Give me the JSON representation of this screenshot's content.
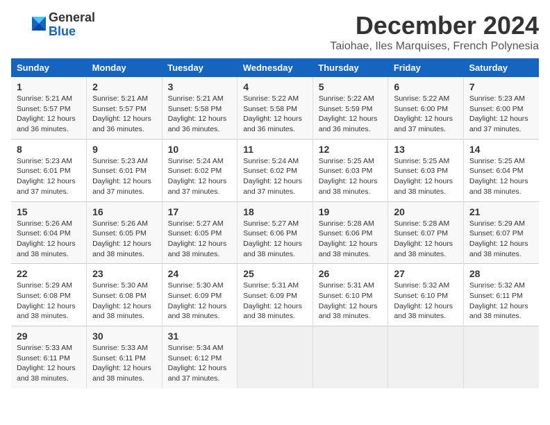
{
  "header": {
    "logo_general": "General",
    "logo_blue": "Blue",
    "month": "December 2024",
    "location": "Taiohae, Iles Marquises, French Polynesia"
  },
  "days_of_week": [
    "Sunday",
    "Monday",
    "Tuesday",
    "Wednesday",
    "Thursday",
    "Friday",
    "Saturday"
  ],
  "weeks": [
    [
      {
        "day": "1",
        "info": "Sunrise: 5:21 AM\nSunset: 5:57 PM\nDaylight: 12 hours\nand 36 minutes."
      },
      {
        "day": "2",
        "info": "Sunrise: 5:21 AM\nSunset: 5:57 PM\nDaylight: 12 hours\nand 36 minutes."
      },
      {
        "day": "3",
        "info": "Sunrise: 5:21 AM\nSunset: 5:58 PM\nDaylight: 12 hours\nand 36 minutes."
      },
      {
        "day": "4",
        "info": "Sunrise: 5:22 AM\nSunset: 5:58 PM\nDaylight: 12 hours\nand 36 minutes."
      },
      {
        "day": "5",
        "info": "Sunrise: 5:22 AM\nSunset: 5:59 PM\nDaylight: 12 hours\nand 36 minutes."
      },
      {
        "day": "6",
        "info": "Sunrise: 5:22 AM\nSunset: 6:00 PM\nDaylight: 12 hours\nand 37 minutes."
      },
      {
        "day": "7",
        "info": "Sunrise: 5:23 AM\nSunset: 6:00 PM\nDaylight: 12 hours\nand 37 minutes."
      }
    ],
    [
      {
        "day": "8",
        "info": "Sunrise: 5:23 AM\nSunset: 6:01 PM\nDaylight: 12 hours\nand 37 minutes."
      },
      {
        "day": "9",
        "info": "Sunrise: 5:23 AM\nSunset: 6:01 PM\nDaylight: 12 hours\nand 37 minutes."
      },
      {
        "day": "10",
        "info": "Sunrise: 5:24 AM\nSunset: 6:02 PM\nDaylight: 12 hours\nand 37 minutes."
      },
      {
        "day": "11",
        "info": "Sunrise: 5:24 AM\nSunset: 6:02 PM\nDaylight: 12 hours\nand 37 minutes."
      },
      {
        "day": "12",
        "info": "Sunrise: 5:25 AM\nSunset: 6:03 PM\nDaylight: 12 hours\nand 38 minutes."
      },
      {
        "day": "13",
        "info": "Sunrise: 5:25 AM\nSunset: 6:03 PM\nDaylight: 12 hours\nand 38 minutes."
      },
      {
        "day": "14",
        "info": "Sunrise: 5:25 AM\nSunset: 6:04 PM\nDaylight: 12 hours\nand 38 minutes."
      }
    ],
    [
      {
        "day": "15",
        "info": "Sunrise: 5:26 AM\nSunset: 6:04 PM\nDaylight: 12 hours\nand 38 minutes."
      },
      {
        "day": "16",
        "info": "Sunrise: 5:26 AM\nSunset: 6:05 PM\nDaylight: 12 hours\nand 38 minutes."
      },
      {
        "day": "17",
        "info": "Sunrise: 5:27 AM\nSunset: 6:05 PM\nDaylight: 12 hours\nand 38 minutes."
      },
      {
        "day": "18",
        "info": "Sunrise: 5:27 AM\nSunset: 6:06 PM\nDaylight: 12 hours\nand 38 minutes."
      },
      {
        "day": "19",
        "info": "Sunrise: 5:28 AM\nSunset: 6:06 PM\nDaylight: 12 hours\nand 38 minutes."
      },
      {
        "day": "20",
        "info": "Sunrise: 5:28 AM\nSunset: 6:07 PM\nDaylight: 12 hours\nand 38 minutes."
      },
      {
        "day": "21",
        "info": "Sunrise: 5:29 AM\nSunset: 6:07 PM\nDaylight: 12 hours\nand 38 minutes."
      }
    ],
    [
      {
        "day": "22",
        "info": "Sunrise: 5:29 AM\nSunset: 6:08 PM\nDaylight: 12 hours\nand 38 minutes."
      },
      {
        "day": "23",
        "info": "Sunrise: 5:30 AM\nSunset: 6:08 PM\nDaylight: 12 hours\nand 38 minutes."
      },
      {
        "day": "24",
        "info": "Sunrise: 5:30 AM\nSunset: 6:09 PM\nDaylight: 12 hours\nand 38 minutes."
      },
      {
        "day": "25",
        "info": "Sunrise: 5:31 AM\nSunset: 6:09 PM\nDaylight: 12 hours\nand 38 minutes."
      },
      {
        "day": "26",
        "info": "Sunrise: 5:31 AM\nSunset: 6:10 PM\nDaylight: 12 hours\nand 38 minutes."
      },
      {
        "day": "27",
        "info": "Sunrise: 5:32 AM\nSunset: 6:10 PM\nDaylight: 12 hours\nand 38 minutes."
      },
      {
        "day": "28",
        "info": "Sunrise: 5:32 AM\nSunset: 6:11 PM\nDaylight: 12 hours\nand 38 minutes."
      }
    ],
    [
      {
        "day": "29",
        "info": "Sunrise: 5:33 AM\nSunset: 6:11 PM\nDaylight: 12 hours\nand 38 minutes."
      },
      {
        "day": "30",
        "info": "Sunrise: 5:33 AM\nSunset: 6:11 PM\nDaylight: 12 hours\nand 38 minutes."
      },
      {
        "day": "31",
        "info": "Sunrise: 5:34 AM\nSunset: 6:12 PM\nDaylight: 12 hours\nand 37 minutes."
      },
      {
        "day": "",
        "info": ""
      },
      {
        "day": "",
        "info": ""
      },
      {
        "day": "",
        "info": ""
      },
      {
        "day": "",
        "info": ""
      }
    ]
  ]
}
